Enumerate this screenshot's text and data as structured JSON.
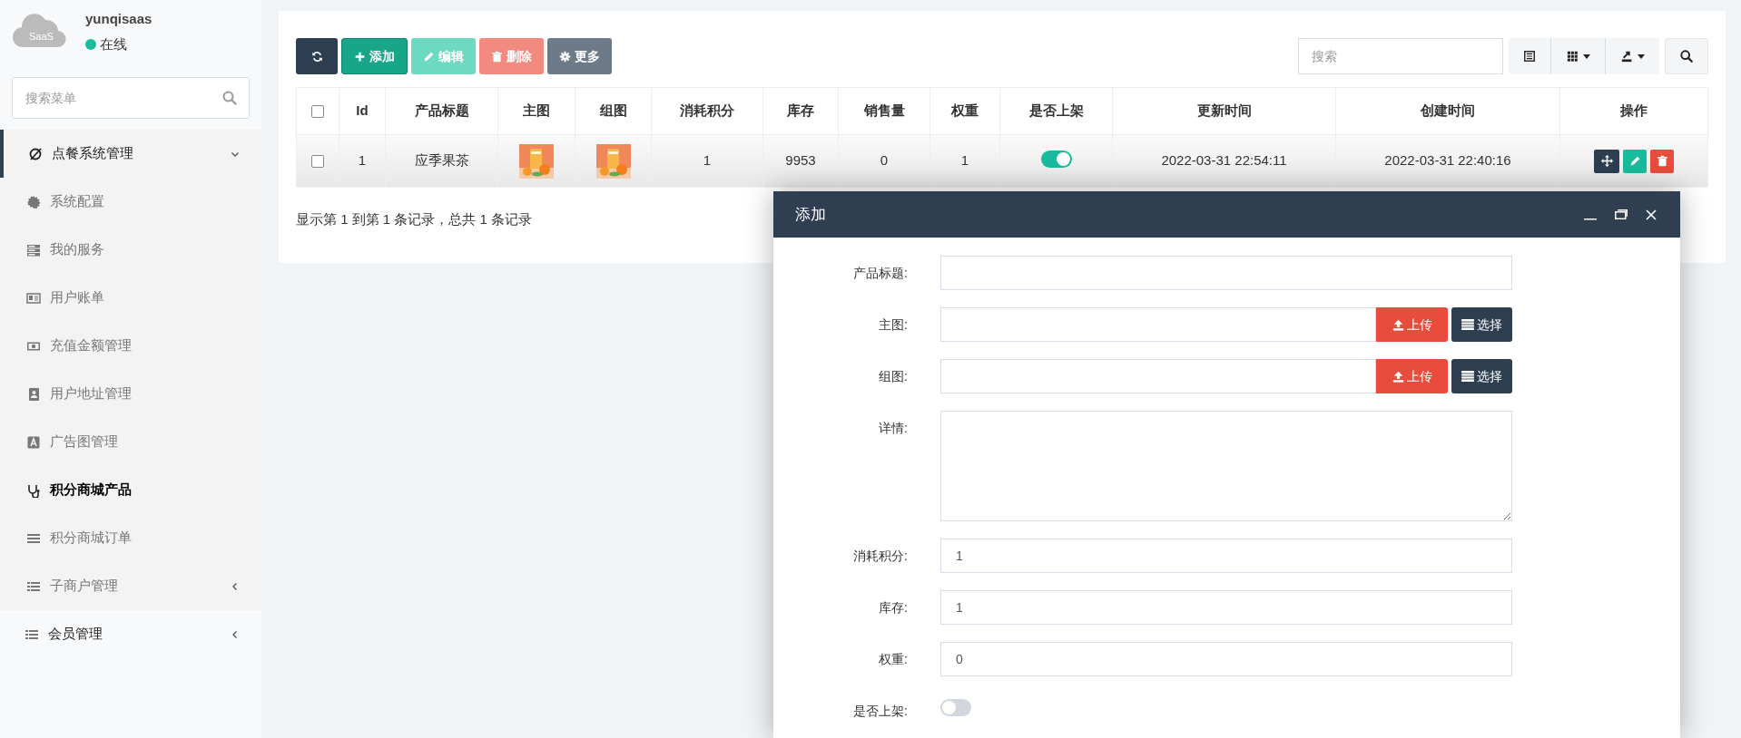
{
  "sidebar": {
    "user": {
      "logo_text": "SaaS",
      "name": "yunqisaas",
      "status": "在线",
      "online": true
    },
    "search": {
      "placeholder": "搜索菜单"
    },
    "menu": [
      {
        "label": "点餐系统管理",
        "selected": false,
        "expanded": true,
        "children": [
          {
            "label": "系统配置",
            "selected": false
          },
          {
            "label": "我的服务",
            "selected": false
          },
          {
            "label": "用户账单",
            "selected": false
          },
          {
            "label": "充值金额管理",
            "selected": false
          },
          {
            "label": "用户地址管理",
            "selected": false
          },
          {
            "label": "广告图管理",
            "selected": false
          },
          {
            "label": "积分商城产品",
            "selected": true
          },
          {
            "label": "积分商城订单",
            "selected": false
          },
          {
            "label": "子商户管理",
            "selected": false,
            "expanded": false
          }
        ]
      },
      {
        "label": "会员管理",
        "selected": false,
        "expanded": false
      }
    ]
  },
  "toolbar": {
    "buttons": [
      {
        "kind": "refresh",
        "disabled": false
      },
      {
        "kind": "add",
        "label": "添加",
        "disabled": false
      },
      {
        "kind": "edit",
        "label": "编辑",
        "disabled": true
      },
      {
        "kind": "delete",
        "label": "删除",
        "disabled": true
      },
      {
        "kind": "more",
        "label": "更多",
        "disabled": false
      }
    ],
    "search": {
      "placeholder": "搜索"
    }
  },
  "table": {
    "select_all_checked": false,
    "columns": [
      "Id",
      "产品标题",
      "主图",
      "组图",
      "消耗积分",
      "库存",
      "销售量",
      "权重",
      "是否上架",
      "更新时间",
      "创建时间",
      "操作"
    ],
    "rows": [
      {
        "checked": false,
        "id": "1",
        "title": "应季果茶",
        "points": "1",
        "stock": "9953",
        "sales": "0",
        "weight": "1",
        "on_sale": true,
        "updated": "2022-03-31 22:54:11",
        "created": "2022-03-31 22:40:16"
      }
    ]
  },
  "pagination": "显示第 1 到第 1 条记录，总共 1 条记录",
  "dialog": {
    "title": "添加",
    "fields": [
      {
        "kind": "text",
        "label": "产品标题:"
      },
      {
        "kind": "upload",
        "label": "主图:",
        "upload": "上传",
        "choose": "选择"
      },
      {
        "kind": "upload",
        "label": "组图:",
        "upload": "上传",
        "choose": "选择"
      },
      {
        "kind": "textarea",
        "label": "详情:"
      },
      {
        "kind": "text",
        "label": "消耗积分:",
        "value": "1"
      },
      {
        "kind": "text",
        "label": "库存:",
        "value": "1"
      },
      {
        "kind": "text",
        "label": "权重:",
        "value": "0"
      },
      {
        "kind": "toggle",
        "label": "是否上架:",
        "on": false
      }
    ]
  }
}
